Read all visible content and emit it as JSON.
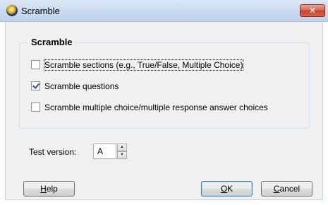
{
  "window": {
    "title": "Scramble",
    "close_glyph": "✕"
  },
  "group": {
    "label": "Scramble",
    "options": [
      {
        "label": "Scramble sections (e.g., True/False, Multiple Choice)",
        "checked": false
      },
      {
        "label": "Scramble questions",
        "checked": true
      },
      {
        "label": "Scramble multiple choice/multiple response answer choices",
        "checked": false
      }
    ]
  },
  "test_version": {
    "label": "Test version:",
    "value": "A",
    "up_glyph": "▲",
    "down_glyph": "▼"
  },
  "buttons": {
    "help": {
      "accel": "H",
      "rest": "elp"
    },
    "ok": {
      "accel": "O",
      "rest": "K"
    },
    "cancel": {
      "accel": "C",
      "rest": "ancel"
    }
  }
}
